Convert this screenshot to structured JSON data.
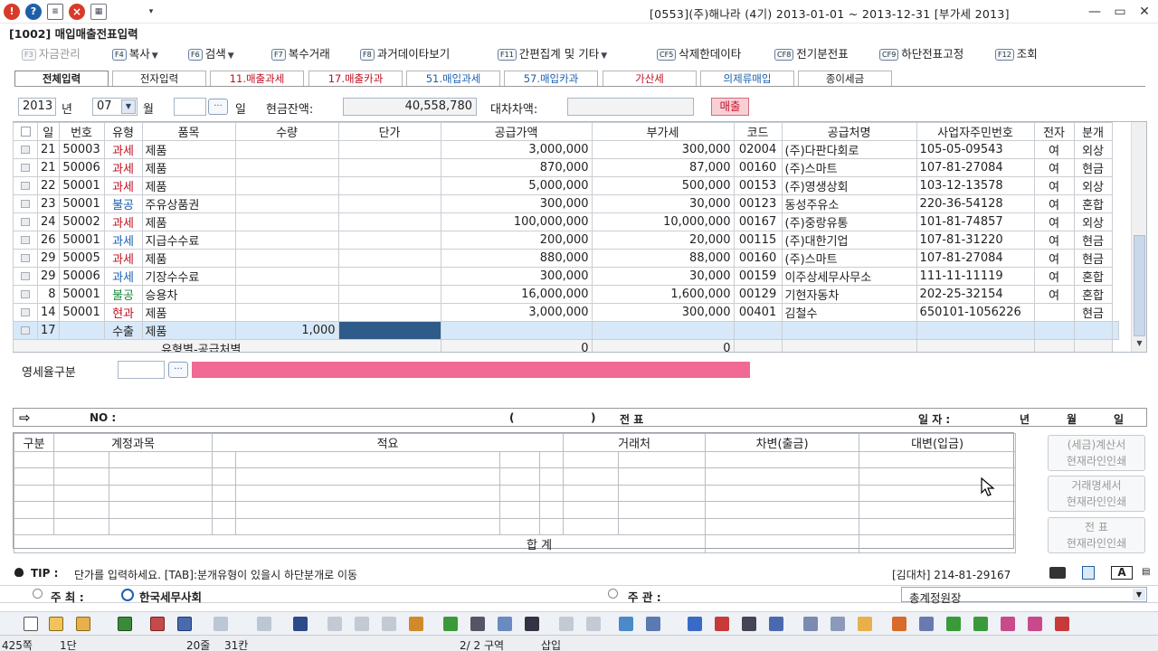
{
  "titlebar": {
    "app_title": "[0553](주)해나라 (4기) 2013-01-01 ~ 2013-12-31 [부가세 2013]",
    "icons": [
      "alert-icon",
      "help-icon",
      "memo-icon",
      "close-icon",
      "calc-icon",
      "menu-dropdown-icon"
    ],
    "minimize": "—",
    "restore": "▭",
    "close": "✕"
  },
  "screen": {
    "code_title": "[1002] 매입매출전표입력"
  },
  "fnbar": [
    {
      "key": "F3",
      "label": "자금관리",
      "disabled": true
    },
    {
      "key": "F4",
      "label": "복사",
      "dropdown": true
    },
    {
      "key": "F6",
      "label": "검색",
      "dropdown": true
    },
    {
      "key": "F7",
      "label": "복수거래"
    },
    {
      "key": "F8",
      "label": "과거데이타보기"
    },
    {
      "key": "F11",
      "label": "간편집계 및 기타",
      "dropdown": true
    },
    {
      "key": "CF5",
      "label": "삭제한데이타"
    },
    {
      "key": "CF8",
      "label": "전기분전표"
    },
    {
      "key": "CF9",
      "label": "하단전표고정"
    },
    {
      "key": "F12",
      "label": "조회"
    }
  ],
  "tabs": [
    "전체입력",
    "전자입력",
    "11.매출과세",
    "17.매출카과",
    "51.매입과세",
    "57.매입카과",
    "가산세",
    "의제류매입",
    "종이세금"
  ],
  "filter": {
    "year": "2013",
    "year_label": "년",
    "month": "07",
    "month_label": "월",
    "day": "",
    "day_label": "일",
    "cash_label": "현금잔액:",
    "cash_value": "40,558,780",
    "diff_label": "대차차액:",
    "diff_value": "",
    "type_badge": "매출"
  },
  "grid": {
    "headers": [
      "일",
      "번호",
      "유형",
      "품목",
      "수량",
      "단가",
      "공급가액",
      "부가세",
      "코드",
      "공급처명",
      "사업자주민번호",
      "전자",
      "분개"
    ],
    "rows": [
      {
        "day": "21",
        "no": "50003",
        "type": "과세",
        "type_color": "red",
        "item": "제품",
        "qty": "",
        "price": "",
        "supply": "3,000,000",
        "vat": "300,000",
        "code": "02004",
        "vendor": "(주)다판다회로",
        "bizno": "105-05-09543",
        "elec": "여",
        "journal": "외상"
      },
      {
        "day": "21",
        "no": "50006",
        "type": "과세",
        "type_color": "red",
        "item": "제품",
        "qty": "",
        "price": "",
        "supply": "870,000",
        "vat": "87,000",
        "code": "00160",
        "vendor": "(주)스마트",
        "bizno": "107-81-27084",
        "elec": "여",
        "journal": "현금"
      },
      {
        "day": "22",
        "no": "50001",
        "type": "과세",
        "type_color": "red",
        "item": "제품",
        "qty": "",
        "price": "",
        "supply": "5,000,000",
        "vat": "500,000",
        "code": "00153",
        "vendor": "(주)영생상회",
        "bizno": "103-12-13578",
        "elec": "여",
        "journal": "외상"
      },
      {
        "day": "23",
        "no": "50001",
        "type": "불공",
        "type_color": "blue",
        "item": "주유상품권",
        "qty": "",
        "price": "",
        "supply": "300,000",
        "vat": "30,000",
        "code": "00123",
        "vendor": "동성주유소",
        "bizno": "220-36-54128",
        "elec": "여",
        "journal": "혼합"
      },
      {
        "day": "24",
        "no": "50002",
        "type": "과세",
        "type_color": "red",
        "item": "제품",
        "qty": "",
        "price": "",
        "supply": "100,000,000",
        "vat": "10,000,000",
        "code": "00167",
        "vendor": "(주)중랑유통",
        "bizno": "101-81-74857",
        "elec": "여",
        "journal": "외상"
      },
      {
        "day": "26",
        "no": "50001",
        "type": "과세",
        "type_color": "blue",
        "item": "지급수수료",
        "qty": "",
        "price": "",
        "supply": "200,000",
        "vat": "20,000",
        "code": "00115",
        "vendor": "(주)대한기업",
        "bizno": "107-81-31220",
        "elec": "여",
        "journal": "현금"
      },
      {
        "day": "29",
        "no": "50005",
        "type": "과세",
        "type_color": "red",
        "item": "제품",
        "qty": "",
        "price": "",
        "supply": "880,000",
        "vat": "88,000",
        "code": "00160",
        "vendor": "(주)스마트",
        "bizno": "107-81-27084",
        "elec": "여",
        "journal": "현금"
      },
      {
        "day": "29",
        "no": "50006",
        "type": "과세",
        "type_color": "blue",
        "item": "기장수수료",
        "qty": "",
        "price": "",
        "supply": "300,000",
        "vat": "30,000",
        "code": "00159",
        "vendor": "이주상세무사무소",
        "bizno": "111-11-11119",
        "elec": "여",
        "journal": "혼합"
      },
      {
        "day": "8",
        "no": "50001",
        "type": "불공",
        "type_color": "green",
        "item": "승용차",
        "qty": "",
        "price": "",
        "supply": "16,000,000",
        "vat": "1,600,000",
        "code": "00129",
        "vendor": "기현자동차",
        "bizno": "202-25-32154",
        "elec": "여",
        "journal": "혼합"
      },
      {
        "day": "14",
        "no": "50001",
        "type": "현과",
        "type_color": "red",
        "item": "제품",
        "qty": "",
        "price": "",
        "supply": "3,000,000",
        "vat": "300,000",
        "code": "00401",
        "vendor": "김철수",
        "bizno": "650101-1056226",
        "elec": "",
        "journal": "현금"
      }
    ],
    "current_row": {
      "day": "17",
      "no": "",
      "type": "수출",
      "item": "제품",
      "qty": "1,000",
      "price": ""
    },
    "summary": {
      "label": "유형별-공급처별",
      "supply": "0",
      "vat": "0"
    }
  },
  "ratio": {
    "label": "영세율구분",
    "value": ""
  },
  "voucher": {
    "arrow": "⇨",
    "no_label": "NO :",
    "paren_open": "(",
    "paren_close": ")",
    "title": "전  표",
    "date_label": "일 자 :",
    "year": "년",
    "month": "월",
    "day": "일"
  },
  "journal": {
    "headers": [
      "구분",
      "계정과목",
      "적요",
      "거래처",
      "차변(출금)",
      "대변(입금)"
    ],
    "total_label": "합  계"
  },
  "side_buttons": [
    {
      "line1": "(세금)계산서",
      "line2": "현재라인인쇄"
    },
    {
      "line1": "거래명세서",
      "line2": "현재라인인쇄"
    },
    {
      "line1": "전   표",
      "line2": "현재라인인쇄"
    }
  ],
  "tip": {
    "label": "TIP :",
    "text": "단가를 입력하세요. [TAB]:분개유형이 있을시 하단분개로 이동",
    "biz": "[김대차] 214-81-29167",
    "a_key": "A"
  },
  "footer_select": {
    "host_label": "주   최 :",
    "host_value": "한국세무사회",
    "org_label": "주   관 :",
    "dropdown_value": "총계정원장"
  },
  "status": {
    "zoom": "425쪽",
    "column": "1단",
    "line": "20줄",
    "col": "31칸",
    "section": "2/ 2 구역",
    "mode": "삽입"
  }
}
